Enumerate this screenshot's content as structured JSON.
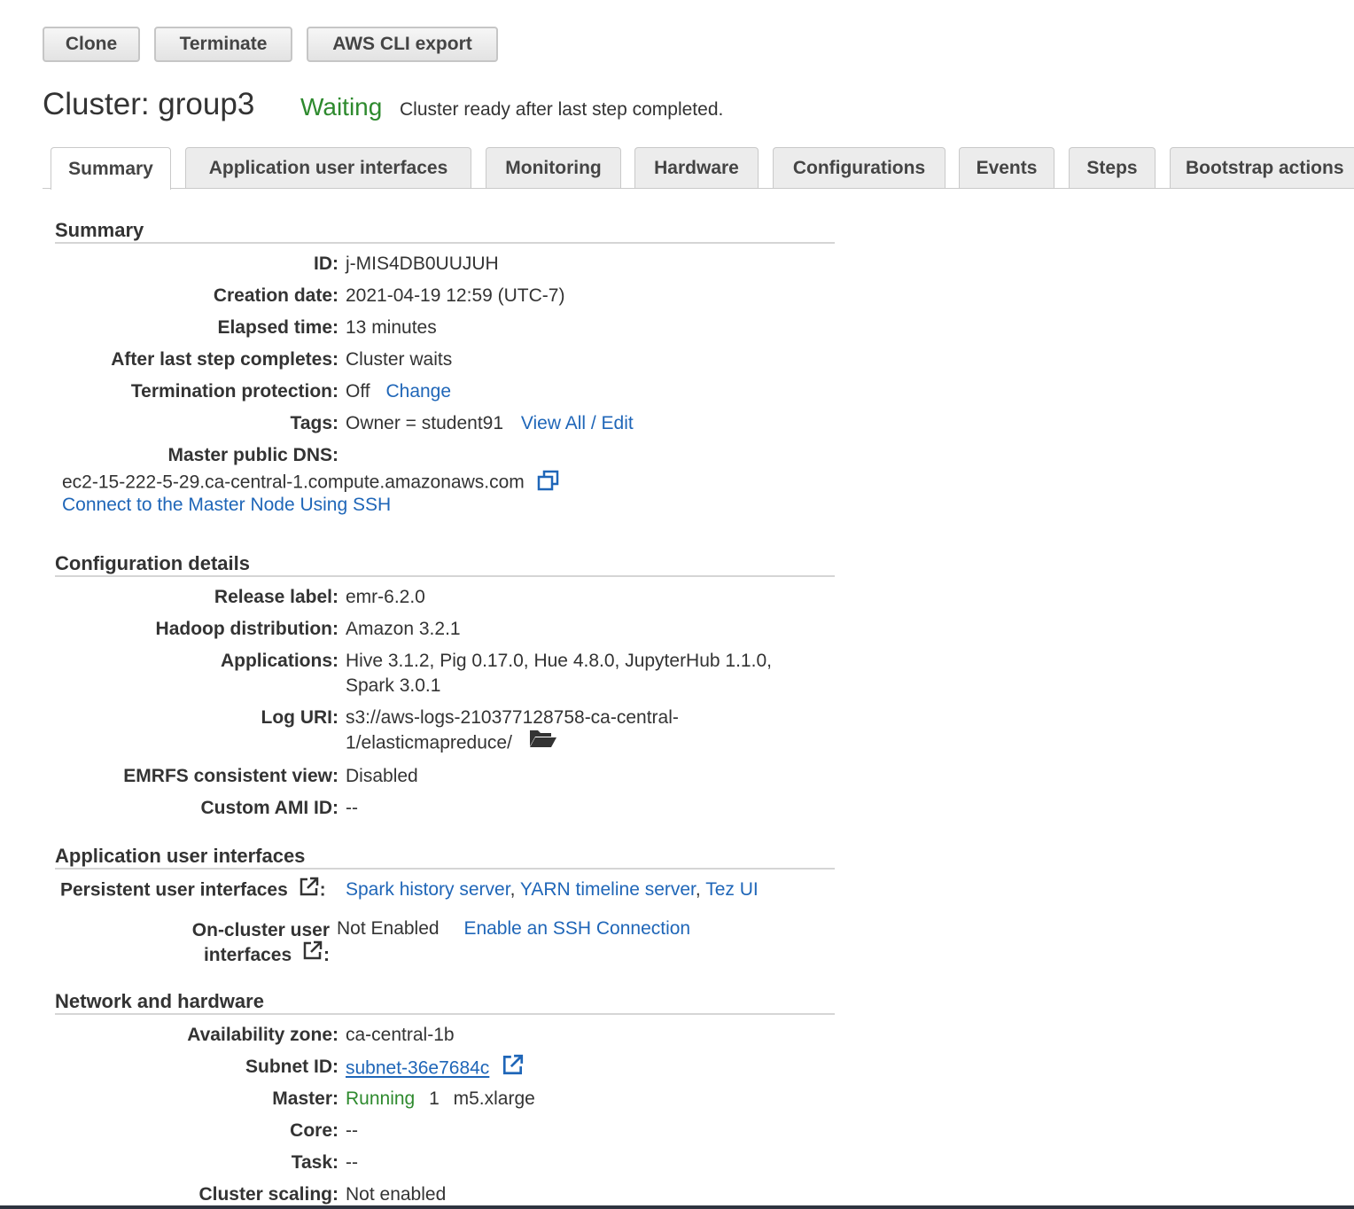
{
  "toolbar": {
    "clone_label": "Clone",
    "terminate_label": "Terminate",
    "cli_export_label": "AWS CLI export"
  },
  "cluster": {
    "title": "Cluster: group3",
    "status": "Waiting",
    "status_message": "Cluster ready after last step completed."
  },
  "tabs": [
    {
      "label": "Summary",
      "active": true
    },
    {
      "label": "Application user interfaces"
    },
    {
      "label": "Monitoring"
    },
    {
      "label": "Hardware"
    },
    {
      "label": "Configurations"
    },
    {
      "label": "Events"
    },
    {
      "label": "Steps"
    },
    {
      "label": "Bootstrap actions"
    }
  ],
  "summary": {
    "heading": "Summary",
    "id_label": "ID:",
    "id_value": "j-MIS4DB0UUJUH",
    "creation_label": "Creation date:",
    "creation_value": "2021-04-19 12:59 (UTC-7)",
    "elapsed_label": "Elapsed time:",
    "elapsed_value": "13 minutes",
    "after_step_label": "After last step completes:",
    "after_step_value": "Cluster waits",
    "termination_label": "Termination protection:",
    "termination_value": "Off",
    "termination_change": "Change",
    "tags_label": "Tags:",
    "tags_value": "Owner = student91",
    "tags_link": "View All / Edit",
    "dns_label": "Master public DNS:",
    "dns_value": "ec2-15-222-5-29.ca-central-1.compute.amazonaws.com",
    "ssh_link": "Connect to the Master Node Using SSH"
  },
  "config": {
    "heading": "Configuration details",
    "release_label": "Release label:",
    "release_value": "emr-6.2.0",
    "hadoop_label": "Hadoop distribution:",
    "hadoop_value": "Amazon 3.2.1",
    "apps_label": "Applications:",
    "apps_line1": "Hive 3.1.2, Pig 0.17.0, Hue 4.8.0, JupyterHub 1.1.0,",
    "apps_line2": "Spark 3.0.1",
    "log_label": "Log URI:",
    "log_line1": "s3://aws-logs-210377128758-ca-central-",
    "log_line2": "1/elasticmapreduce/",
    "emrfs_label": "EMRFS consistent view:",
    "emrfs_value": "Disabled",
    "ami_label": "Custom AMI ID:",
    "ami_value": "--"
  },
  "app_ui": {
    "heading": "Application user interfaces",
    "persistent_label": "Persistent user interfaces",
    "spark_link": "Spark history server",
    "yarn_link": "YARN timeline server",
    "tez_link": "Tez UI",
    "sep": ",",
    "colon": ":",
    "oncluster_label_1": "On-cluster user",
    "oncluster_label_2": "interfaces",
    "oncluster_value": "Not Enabled",
    "oncluster_link": "Enable an SSH Connection"
  },
  "network": {
    "heading": "Network and hardware",
    "az_label": "Availability zone:",
    "az_value": "ca-central-1b",
    "subnet_label": "Subnet ID:",
    "subnet_value": "subnet-36e7684c",
    "master_label": "Master:",
    "master_status": "Running",
    "master_count": "1",
    "master_type": "m5.xlarge",
    "core_label": "Core:",
    "core_value": "--",
    "task_label": "Task:",
    "task_value": "--",
    "scaling_label": "Cluster scaling:",
    "scaling_value": "Not enabled"
  },
  "icons": {
    "copy": "copy-icon",
    "folder": "folder-open-icon",
    "external": "external-link-icon"
  },
  "colors": {
    "link": "#1f66b8",
    "status_green": "#2e8a2e"
  }
}
